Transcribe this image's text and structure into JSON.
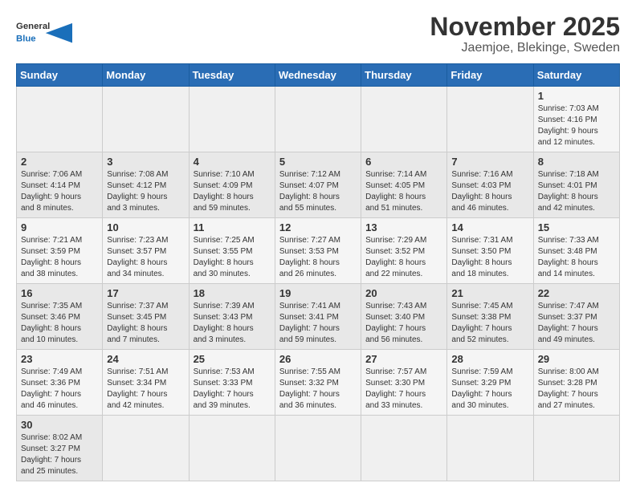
{
  "header": {
    "logo_general": "General",
    "logo_blue": "Blue",
    "title": "November 2025",
    "subtitle": "Jaemjoe, Blekinge, Sweden"
  },
  "weekdays": [
    "Sunday",
    "Monday",
    "Tuesday",
    "Wednesday",
    "Thursday",
    "Friday",
    "Saturday"
  ],
  "weeks": [
    [
      {
        "day": "",
        "info": ""
      },
      {
        "day": "",
        "info": ""
      },
      {
        "day": "",
        "info": ""
      },
      {
        "day": "",
        "info": ""
      },
      {
        "day": "",
        "info": ""
      },
      {
        "day": "",
        "info": ""
      },
      {
        "day": "1",
        "info": "Sunrise: 7:03 AM\nSunset: 4:16 PM\nDaylight: 9 hours\nand 12 minutes."
      }
    ],
    [
      {
        "day": "2",
        "info": "Sunrise: 7:06 AM\nSunset: 4:14 PM\nDaylight: 9 hours\nand 8 minutes."
      },
      {
        "day": "3",
        "info": "Sunrise: 7:08 AM\nSunset: 4:12 PM\nDaylight: 9 hours\nand 3 minutes."
      },
      {
        "day": "4",
        "info": "Sunrise: 7:10 AM\nSunset: 4:09 PM\nDaylight: 8 hours\nand 59 minutes."
      },
      {
        "day": "5",
        "info": "Sunrise: 7:12 AM\nSunset: 4:07 PM\nDaylight: 8 hours\nand 55 minutes."
      },
      {
        "day": "6",
        "info": "Sunrise: 7:14 AM\nSunset: 4:05 PM\nDaylight: 8 hours\nand 51 minutes."
      },
      {
        "day": "7",
        "info": "Sunrise: 7:16 AM\nSunset: 4:03 PM\nDaylight: 8 hours\nand 46 minutes."
      },
      {
        "day": "8",
        "info": "Sunrise: 7:18 AM\nSunset: 4:01 PM\nDaylight: 8 hours\nand 42 minutes."
      }
    ],
    [
      {
        "day": "9",
        "info": "Sunrise: 7:21 AM\nSunset: 3:59 PM\nDaylight: 8 hours\nand 38 minutes."
      },
      {
        "day": "10",
        "info": "Sunrise: 7:23 AM\nSunset: 3:57 PM\nDaylight: 8 hours\nand 34 minutes."
      },
      {
        "day": "11",
        "info": "Sunrise: 7:25 AM\nSunset: 3:55 PM\nDaylight: 8 hours\nand 30 minutes."
      },
      {
        "day": "12",
        "info": "Sunrise: 7:27 AM\nSunset: 3:53 PM\nDaylight: 8 hours\nand 26 minutes."
      },
      {
        "day": "13",
        "info": "Sunrise: 7:29 AM\nSunset: 3:52 PM\nDaylight: 8 hours\nand 22 minutes."
      },
      {
        "day": "14",
        "info": "Sunrise: 7:31 AM\nSunset: 3:50 PM\nDaylight: 8 hours\nand 18 minutes."
      },
      {
        "day": "15",
        "info": "Sunrise: 7:33 AM\nSunset: 3:48 PM\nDaylight: 8 hours\nand 14 minutes."
      }
    ],
    [
      {
        "day": "16",
        "info": "Sunrise: 7:35 AM\nSunset: 3:46 PM\nDaylight: 8 hours\nand 10 minutes."
      },
      {
        "day": "17",
        "info": "Sunrise: 7:37 AM\nSunset: 3:45 PM\nDaylight: 8 hours\nand 7 minutes."
      },
      {
        "day": "18",
        "info": "Sunrise: 7:39 AM\nSunset: 3:43 PM\nDaylight: 8 hours\nand 3 minutes."
      },
      {
        "day": "19",
        "info": "Sunrise: 7:41 AM\nSunset: 3:41 PM\nDaylight: 7 hours\nand 59 minutes."
      },
      {
        "day": "20",
        "info": "Sunrise: 7:43 AM\nSunset: 3:40 PM\nDaylight: 7 hours\nand 56 minutes."
      },
      {
        "day": "21",
        "info": "Sunrise: 7:45 AM\nSunset: 3:38 PM\nDaylight: 7 hours\nand 52 minutes."
      },
      {
        "day": "22",
        "info": "Sunrise: 7:47 AM\nSunset: 3:37 PM\nDaylight: 7 hours\nand 49 minutes."
      }
    ],
    [
      {
        "day": "23",
        "info": "Sunrise: 7:49 AM\nSunset: 3:36 PM\nDaylight: 7 hours\nand 46 minutes."
      },
      {
        "day": "24",
        "info": "Sunrise: 7:51 AM\nSunset: 3:34 PM\nDaylight: 7 hours\nand 42 minutes."
      },
      {
        "day": "25",
        "info": "Sunrise: 7:53 AM\nSunset: 3:33 PM\nDaylight: 7 hours\nand 39 minutes."
      },
      {
        "day": "26",
        "info": "Sunrise: 7:55 AM\nSunset: 3:32 PM\nDaylight: 7 hours\nand 36 minutes."
      },
      {
        "day": "27",
        "info": "Sunrise: 7:57 AM\nSunset: 3:30 PM\nDaylight: 7 hours\nand 33 minutes."
      },
      {
        "day": "28",
        "info": "Sunrise: 7:59 AM\nSunset: 3:29 PM\nDaylight: 7 hours\nand 30 minutes."
      },
      {
        "day": "29",
        "info": "Sunrise: 8:00 AM\nSunset: 3:28 PM\nDaylight: 7 hours\nand 27 minutes."
      }
    ],
    [
      {
        "day": "30",
        "info": "Sunrise: 8:02 AM\nSunset: 3:27 PM\nDaylight: 7 hours\nand 25 minutes."
      },
      {
        "day": "",
        "info": ""
      },
      {
        "day": "",
        "info": ""
      },
      {
        "day": "",
        "info": ""
      },
      {
        "day": "",
        "info": ""
      },
      {
        "day": "",
        "info": ""
      },
      {
        "day": "",
        "info": ""
      }
    ]
  ]
}
